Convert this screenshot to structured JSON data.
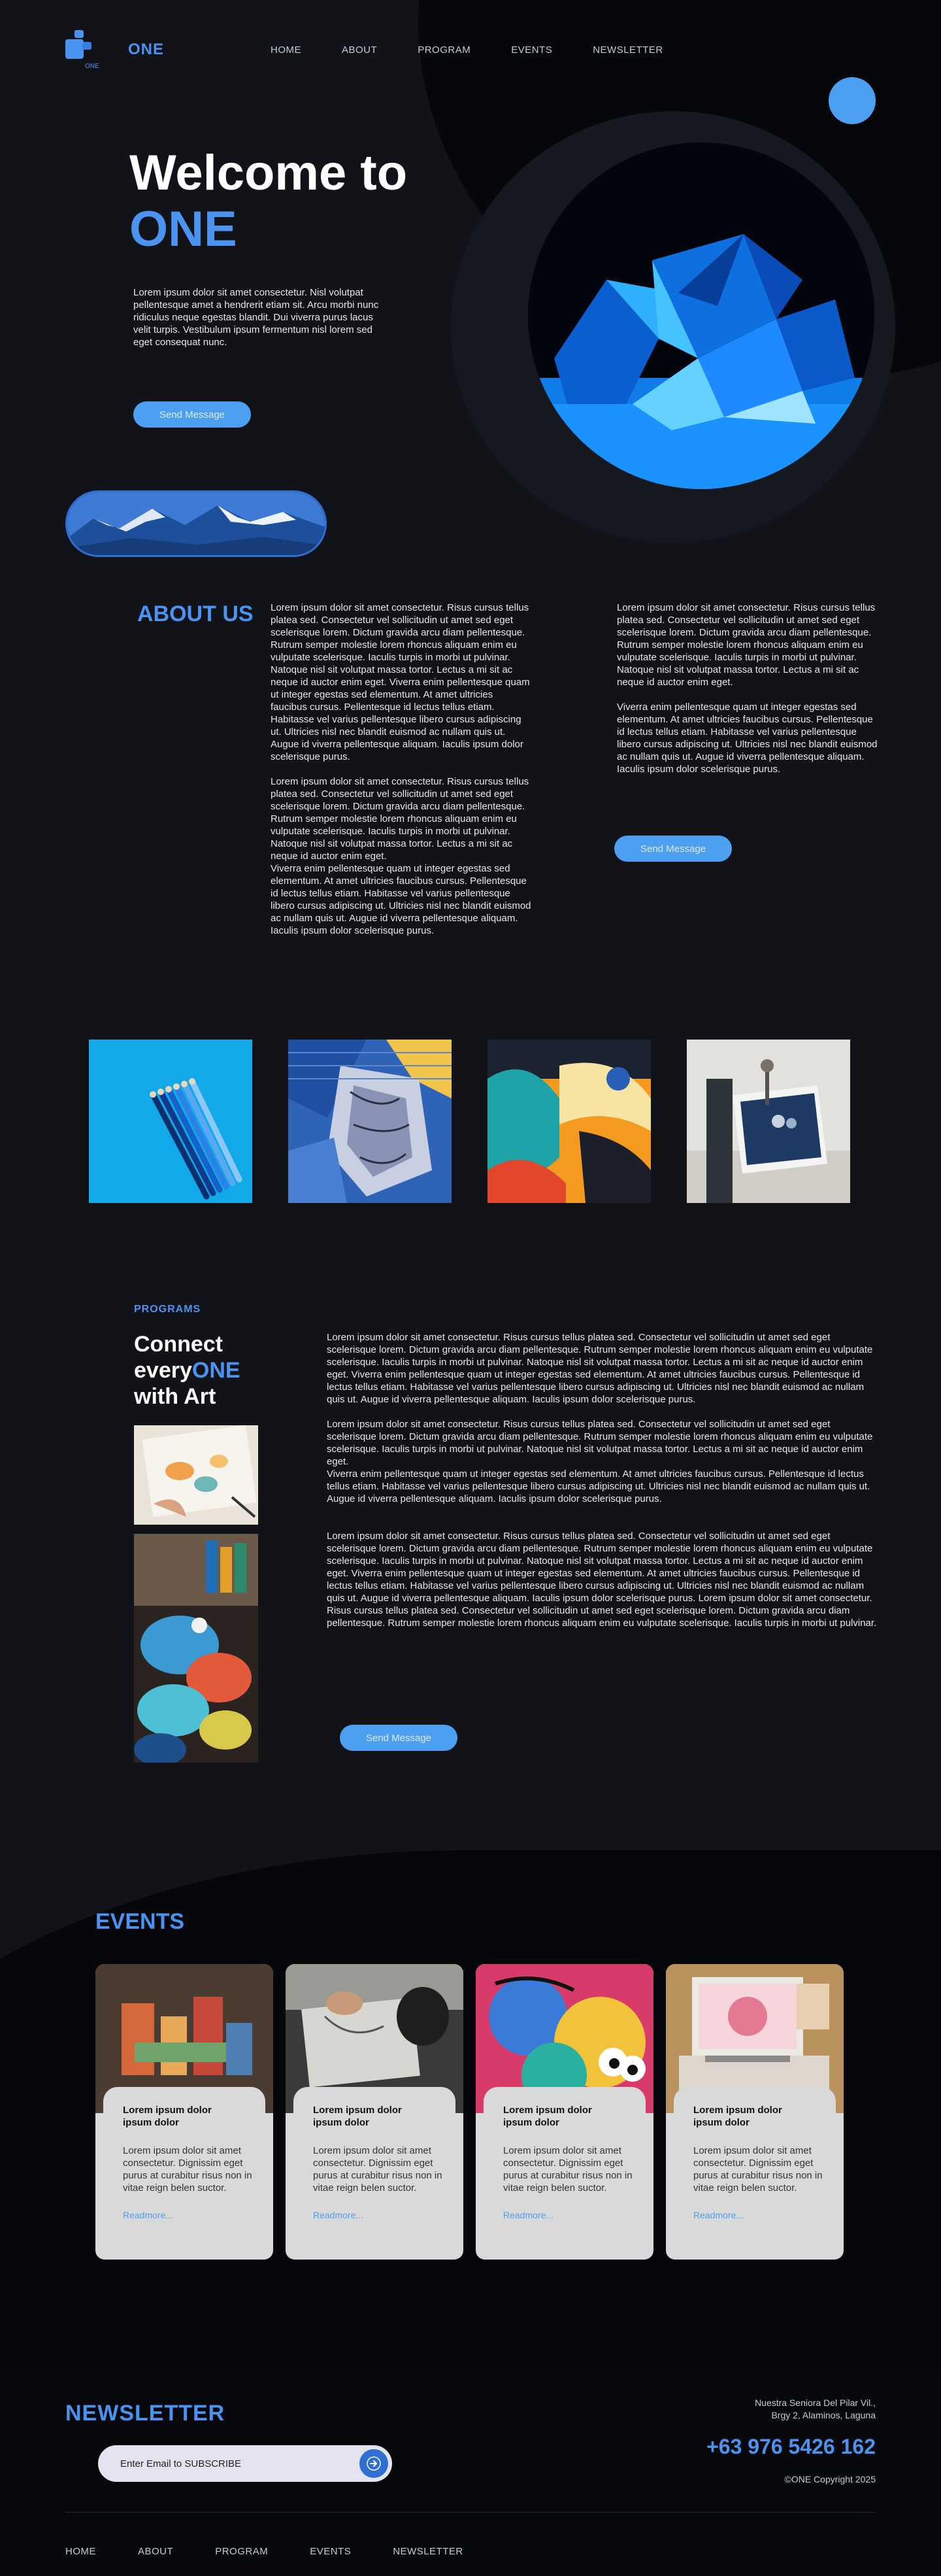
{
  "header": {
    "logo_text": "ONE",
    "logo_subtext": "ONE",
    "nav": [
      "HOME",
      "ABOUT",
      "PROGRAM",
      "EVENTS",
      "NEWSLETTER"
    ]
  },
  "hero": {
    "title_line1": "Welcome to",
    "title_line2": "ONE",
    "text": "Lorem ipsum dolor sit amet consectetur. Nisl volutpat pellentesque amet a hendrerit etiam sit. Arcu morbi nunc ridiculus neque egestas blandit. Dui viverra purus lacus velit turpis. Vestibulum ipsum fermentum nisl lorem sed eget consequat nunc.",
    "button": "Send Message"
  },
  "about": {
    "heading": "ABOUT US",
    "col1_p1": "Lorem ipsum dolor sit amet consectetur. Risus cursus tellus platea sed. Consectetur vel sollicitudin ut amet sed eget scelerisque lorem. Dictum gravida arcu diam pellentesque. Rutrum semper molestie lorem rhoncus aliquam enim eu vulputate scelerisque. Iaculis turpis in morbi ut pulvinar. Natoque nisl sit volutpat massa tortor. Lectus a mi sit ac neque id auctor enim eget. Viverra enim pellentesque quam ut integer egestas sed elementum. At amet ultricies faucibus cursus. Pellentesque id lectus tellus etiam. Habitasse vel varius pellentesque libero cursus adipiscing ut. Ultricies nisl nec blandit euismod ac nullam quis ut. Augue id viverra pellentesque aliquam. Iaculis ipsum dolor scelerisque purus.",
    "col1_p2": "Lorem ipsum dolor sit amet consectetur. Risus cursus tellus platea sed. Consectetur vel sollicitudin ut amet sed eget scelerisque lorem. Dictum gravida arcu diam pellentesque. Rutrum semper molestie lorem rhoncus aliquam enim eu vulputate scelerisque. Iaculis turpis in morbi ut pulvinar. Natoque nisl sit volutpat massa tortor. Lectus a mi sit ac neque id auctor enim eget.",
    "col1_p3": "Viverra enim pellentesque quam ut integer egestas sed elementum. At amet ultricies faucibus cursus. Pellentesque id lectus tellus etiam. Habitasse vel varius pellentesque libero cursus adipiscing ut. Ultricies nisl nec blandit euismod ac nullam quis ut. Augue id viverra pellentesque aliquam. Iaculis ipsum dolor scelerisque purus.",
    "col2_p1": "Lorem ipsum dolor sit amet consectetur. Risus cursus tellus platea sed. Consectetur vel sollicitudin ut amet sed eget scelerisque lorem. Dictum gravida arcu diam pellentesque. Rutrum semper molestie lorem rhoncus aliquam enim eu vulputate scelerisque. Iaculis turpis in morbi ut pulvinar. Natoque nisl sit volutpat massa tortor. Lectus a mi sit ac neque id auctor enim eget.",
    "col2_p2": "Viverra enim pellentesque quam ut integer egestas sed elementum. At amet ultricies faucibus cursus. Pellentesque id lectus tellus etiam. Habitasse vel varius pellentesque libero cursus adipiscing ut. Ultricies nisl nec blandit euismod ac nullam quis ut. Augue id viverra pellentesque aliquam. Iaculis ipsum dolor scelerisque purus.",
    "button": "Send Message"
  },
  "programs": {
    "label": "PROGRAMS",
    "title_part1": "Connect every",
    "title_accent": "ONE",
    "title_part2": "with Art",
    "p1": "Lorem ipsum dolor sit amet consectetur. Risus cursus tellus platea sed. Consectetur vel sollicitudin ut amet sed eget scelerisque lorem. Dictum gravida arcu diam pellentesque. Rutrum semper molestie lorem rhoncus aliquam enim eu vulputate scelerisque. Iaculis turpis in morbi ut pulvinar. Natoque nisl sit volutpat massa tortor. Lectus a mi sit ac neque id auctor enim eget. Viverra enim pellentesque quam ut integer egestas sed elementum. At amet ultricies faucibus cursus. Pellentesque id lectus tellus etiam. Habitasse vel varius pellentesque libero cursus adipiscing ut. Ultricies nisl nec blandit euismod ac nullam quis ut. Augue id viverra pellentesque aliquam. Iaculis ipsum dolor scelerisque purus.",
    "p2": "Lorem ipsum dolor sit amet consectetur. Risus cursus tellus platea sed. Consectetur vel sollicitudin ut amet sed eget scelerisque lorem. Dictum gravida arcu diam pellentesque. Rutrum semper molestie lorem rhoncus aliquam enim eu vulputate scelerisque. Iaculis turpis in morbi ut pulvinar. Natoque nisl sit volutpat massa tortor. Lectus a mi sit ac neque id auctor enim eget.",
    "p3": "Viverra enim pellentesque quam ut integer egestas sed elementum. At amet ultricies faucibus cursus. Pellentesque id lectus tellus etiam. Habitasse vel varius pellentesque libero cursus adipiscing ut. Ultricies nisl nec blandit euismod ac nullam quis ut. Augue id viverra pellentesque aliquam. Iaculis ipsum dolor scelerisque purus.",
    "p4": "Lorem ipsum dolor sit amet consectetur. Risus cursus tellus platea sed. Consectetur vel sollicitudin ut amet sed eget scelerisque lorem. Dictum gravida arcu diam pellentesque. Rutrum semper molestie lorem rhoncus aliquam enim eu vulputate scelerisque. Iaculis turpis in morbi ut pulvinar. Natoque nisl sit volutpat massa tortor. Lectus a mi sit ac neque id auctor enim eget. Viverra enim pellentesque quam ut integer egestas sed elementum. At amet ultricies faucibus cursus. Pellentesque id lectus tellus etiam. Habitasse vel varius pellentesque libero cursus adipiscing ut. Ultricies nisl nec blandit euismod ac nullam quis ut. Augue id viverra pellentesque aliquam. Iaculis ipsum dolor scelerisque purus. Lorem ipsum dolor sit amet consectetur. Risus cursus tellus platea sed. Consectetur vel sollicitudin ut amet sed eget scelerisque lorem. Dictum gravida arcu diam pellentesque. Rutrum semper molestie lorem rhoncus aliquam enim eu vulputate scelerisque. Iaculis turpis in morbi ut pulvinar.",
    "button": "Send Message"
  },
  "events": {
    "heading": "EVENTS",
    "cards": [
      {
        "title": "Lorem ipsum dolor ipsum dolor",
        "text": "Lorem ipsum dolor sit amet consectetur. Dignissim eget purus at curabitur risus non in vitae reign belen suctor.",
        "link": "Readmore..."
      },
      {
        "title": "Lorem ipsum dolor ipsum dolor",
        "text": "Lorem ipsum dolor sit amet consectetur. Dignissim eget purus at curabitur risus non in vitae reign belen suctor.",
        "link": "Readmore..."
      },
      {
        "title": "Lorem ipsum dolor ipsum dolor",
        "text": "Lorem ipsum dolor sit amet consectetur. Dignissim eget purus at curabitur risus non in vitae reign belen suctor.",
        "link": "Readmore..."
      },
      {
        "title": "Lorem ipsum dolor ipsum dolor",
        "text": "Lorem ipsum dolor sit amet consectetur. Dignissim eget purus at curabitur risus non in vitae reign belen suctor.",
        "link": "Readmore..."
      }
    ]
  },
  "newsletter": {
    "heading": "NEWSLETTER",
    "input_placeholder": "Enter Email to SUBSCRIBE",
    "address_line1": "Nuestra Seniora Del Pilar Vil.,",
    "address_line2": "Brgy 2, Alaminos, Laguna",
    "phone": "+63 976 5426 162",
    "copyright": "©ONE Copyright 2025"
  },
  "footer": {
    "nav": [
      "HOME",
      "ABOUT",
      "PROGRAM",
      "EVENTS",
      "NEWSLETTER"
    ]
  },
  "colors": {
    "background": "#111319",
    "accent": "#4b93f0",
    "button": "#4d9ff1",
    "card": "#d9d9d9"
  }
}
